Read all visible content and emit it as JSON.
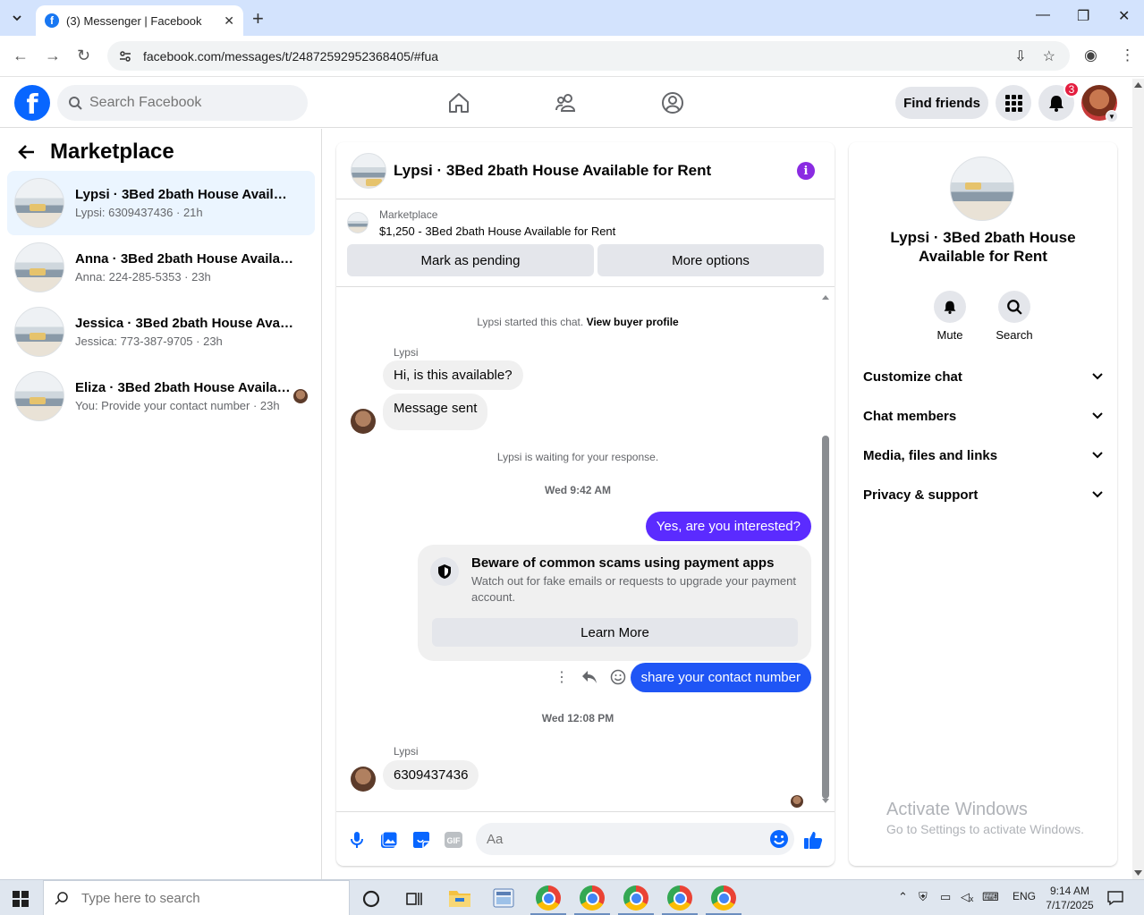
{
  "browser": {
    "tab_title": "(3) Messenger | Facebook",
    "url": "facebook.com/messages/t/24872592952368405/#fua"
  },
  "fb_header": {
    "search_placeholder": "Search Facebook",
    "find_friends": "Find friends",
    "notifications_count": "3"
  },
  "left_panel": {
    "title": "Marketplace",
    "conversations": [
      {
        "name": "Lypsi · 3Bed 2bath House Available for Rent",
        "preview": "Lypsi: 6309437436 · 21h"
      },
      {
        "name": "Anna · 3Bed 2bath House Available for Rent",
        "preview": "Anna: 224-285-5353 · 23h"
      },
      {
        "name": "Jessica · 3Bed 2bath House Available for Rent",
        "preview": "Jessica: 773-387-9705 · 23h"
      },
      {
        "name": "Eliza · 3Bed 2bath House Available for Rent",
        "preview": "You: Provide your contact number · 23h"
      }
    ]
  },
  "chat": {
    "title": "Lypsi · 3Bed 2bath House Available for Rent",
    "marketplace_label": "Marketplace",
    "listing": "$1,250 - 3Bed 2bath House Available for Rent",
    "mark_pending": "Mark as pending",
    "more_options": "More options",
    "started_text": "Lypsi started this chat.",
    "view_buyer_profile": "View buyer profile",
    "sender_1": "Lypsi",
    "msg_1": "Hi, is this available?",
    "msg_2": "Message sent",
    "waiting": "Lypsi is waiting for your response.",
    "time_1": "Wed 9:42 AM",
    "out_1": "Yes, are you interested?",
    "scam_title": "Beware of common scams using payment apps",
    "scam_text": "Watch out for fake emails or requests to upgrade your payment account.",
    "learn_more": "Learn More",
    "out_2": "share your contact number",
    "time_2": "Wed 12:08 PM",
    "sender_2": "Lypsi",
    "msg_3": "6309437436",
    "composer_placeholder": "Aa"
  },
  "info_panel": {
    "name": "Lypsi · 3Bed 2bath House Available for Rent",
    "mute": "Mute",
    "search": "Search",
    "sections": [
      "Customize chat",
      "Chat members",
      "Media, files and links",
      "Privacy & support"
    ],
    "watermark_title": "Activate Windows",
    "watermark_sub": "Go to Settings to activate Windows."
  },
  "taskbar": {
    "search_placeholder": "Type here to search",
    "lang": "ENG",
    "time": "9:14 AM",
    "date": "7/17/2025"
  },
  "colors": {
    "fb_blue": "#0866ff",
    "outgoing_purple": "#5b2bff",
    "outgoing_blue": "#1f55f5",
    "active_conv_bg": "#ebf5ff"
  }
}
